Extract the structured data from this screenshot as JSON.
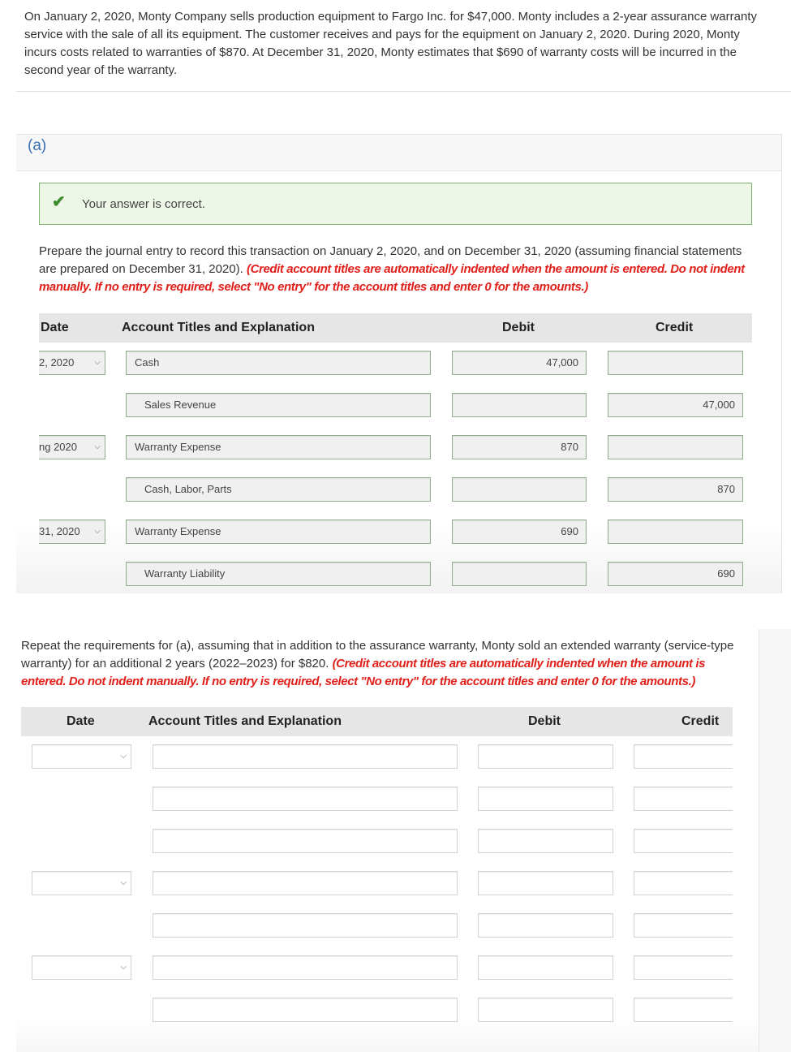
{
  "problem": "On January 2, 2020, Monty Company sells production equipment to Fargo Inc. for $47,000. Monty includes a 2-year assurance warranty service with the sale of all its equipment. The customer receives and pays for the equipment on January 2, 2020. During 2020, Monty incurs costs related to warranties of $870. At December 31, 2020, Monty estimates that $690 of warranty costs will be incurred in the second year of the warranty.",
  "part_a": {
    "label": "(a)",
    "feedback": "Your answer is correct.",
    "instructions": "Prepare the journal entry to record this transaction on January 2, 2020, and on December 31, 2020 (assuming financial statements are prepared on December 31, 2020). ",
    "note": "(Credit account titles are automatically indented when the amount is entered. Do not indent manually. If no entry is required, select \"No entry\" for the account titles and enter 0 for the amounts.)",
    "headers": {
      "date": "Date",
      "account": "Account Titles and Explanation",
      "debit": "Debit",
      "credit": "Credit"
    },
    "rows": [
      {
        "date": "2, 2020",
        "account": "Cash",
        "debit": "47,000",
        "credit": ""
      },
      {
        "date": "",
        "account": "Sales Revenue",
        "debit": "",
        "credit": "47,000"
      },
      {
        "date": "ng 2020",
        "account": "Warranty Expense",
        "debit": "870",
        "credit": ""
      },
      {
        "date": "",
        "account": "Cash, Labor, Parts",
        "debit": "",
        "credit": "870"
      },
      {
        "date": "31, 2020",
        "account": "Warranty Expense",
        "debit": "690",
        "credit": ""
      },
      {
        "date": "",
        "account": "Warranty Liability",
        "debit": "",
        "credit": "690"
      }
    ]
  },
  "part_b": {
    "instructions": "Repeat the requirements for (a), assuming that in addition to the assurance warranty, Monty sold an extended warranty (service-type warranty) for an additional 2 years (2022–2023) for $820. ",
    "note": "(Credit account titles are automatically indented when the amount is entered. Do not indent manually. If no entry is required, select \"No entry\" for the account titles and enter 0 for the amounts.)",
    "headers": {
      "date": "Date",
      "account": "Account Titles and Explanation",
      "debit": "Debit",
      "credit": "Credit"
    }
  },
  "colors": {
    "success_bg": "#eef6e8",
    "success_border": "#7fb46e",
    "check": "#3d8b2f",
    "note": "#e0201b",
    "link": "#3a6fb0"
  },
  "icons": {
    "check": "check-icon",
    "chevron": "chevron-down-icon"
  }
}
